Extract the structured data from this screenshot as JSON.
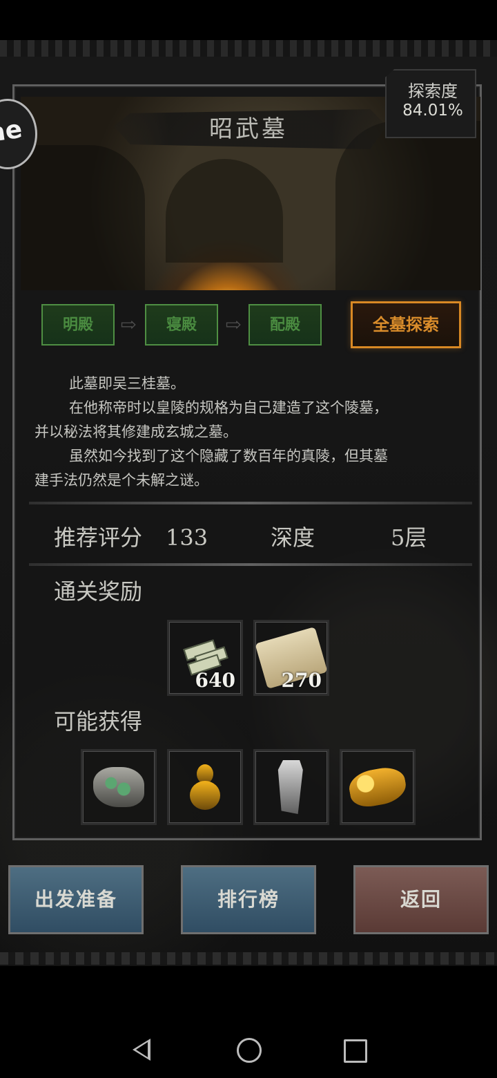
{
  "map": {
    "title": "昭武墓",
    "explore_label": "探索度",
    "explore_value": "84.01%",
    "side_badge": "ne"
  },
  "path": {
    "rooms": [
      "明殿",
      "寝殿",
      "配殿"
    ],
    "all_explore": "全墓探索"
  },
  "description": {
    "line1": "此墓即吴三桂墓。",
    "line2": "在他称帝时以皇陵的规格为自己建造了这个陵墓，",
    "line3": "并以秘法将其修建成玄城之墓。",
    "line4": "虽然如今找到了这个隐藏了数百年的真陵，但其墓",
    "line5": "建手法仍然是个未解之谜。"
  },
  "stats": {
    "recommend_label": "推荐评分",
    "recommend_value": "133",
    "depth_label": "深度",
    "depth_value": "5层"
  },
  "rewards": {
    "title": "通关奖励",
    "items": [
      {
        "icon": "money-icon",
        "count": "640"
      },
      {
        "icon": "scroll-icon",
        "count": "270"
      }
    ]
  },
  "possible": {
    "title": "可能获得",
    "items": [
      {
        "icon": "stone-icon"
      },
      {
        "icon": "gourd-icon"
      },
      {
        "icon": "token-icon"
      },
      {
        "icon": "gold-icon"
      }
    ]
  },
  "buttons": {
    "prepare": "出发准备",
    "ranking": "排行榜",
    "return": "返回"
  },
  "colors": {
    "path_green": "#4a8b40",
    "all_explore_orange": "#da8d2b",
    "blue_button": "#4e6e82",
    "red_button": "#7c5b55"
  }
}
